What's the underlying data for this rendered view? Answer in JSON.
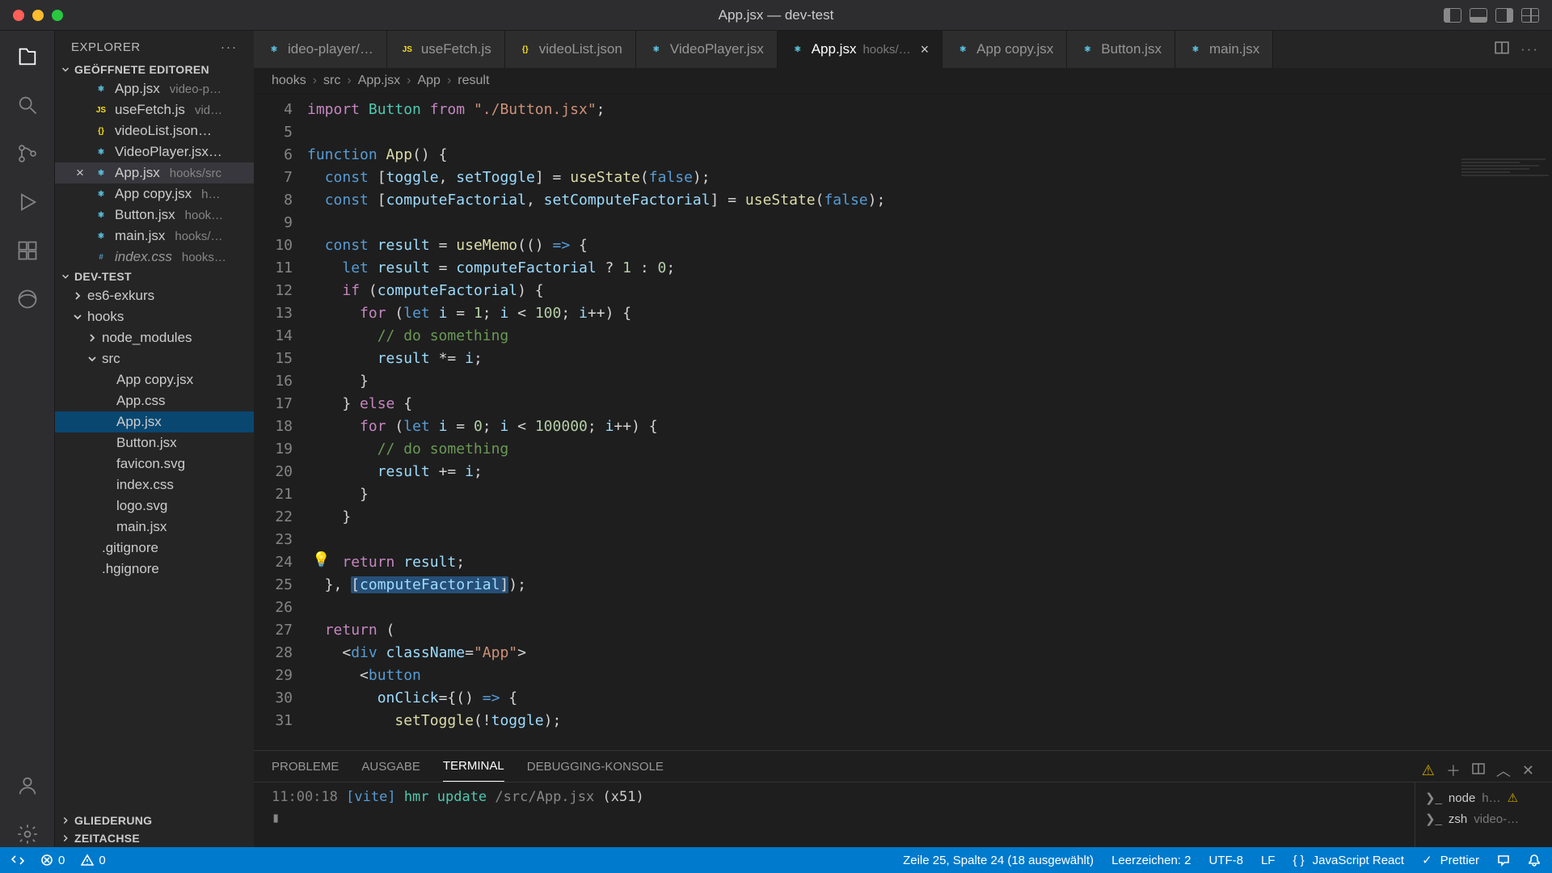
{
  "window": {
    "title": "App.jsx — dev-test"
  },
  "sidebar_header": "EXPLORER",
  "sections": {
    "open_editors": "GEÖFFNETE EDITOREN",
    "project": "DEV-TEST",
    "outline": "GLIEDERUNG",
    "timeline": "ZEITACHSE"
  },
  "open_editors": [
    {
      "name": "App.jsx",
      "path": "video-p…",
      "icon": "react"
    },
    {
      "name": "useFetch.js",
      "path": "vid…",
      "icon": "js"
    },
    {
      "name": "videoList.json…",
      "path": "",
      "icon": "json"
    },
    {
      "name": "VideoPlayer.jsx…",
      "path": "",
      "icon": "react"
    },
    {
      "name": "App.jsx",
      "path": "hooks/src",
      "icon": "react",
      "active": true,
      "close": "×"
    },
    {
      "name": "App copy.jsx",
      "path": "h…",
      "icon": "react"
    },
    {
      "name": "Button.jsx",
      "path": "hook…",
      "icon": "react"
    },
    {
      "name": "main.jsx",
      "path": "hooks/…",
      "icon": "react"
    },
    {
      "name": "index.css",
      "path": "hooks…",
      "icon": "css",
      "dim": true
    }
  ],
  "tree": [
    {
      "label": "es6-exkurs",
      "depth": 1,
      "chev": "right"
    },
    {
      "label": "hooks",
      "depth": 1,
      "chev": "down"
    },
    {
      "label": "node_modules",
      "depth": 2,
      "chev": "right"
    },
    {
      "label": "src",
      "depth": 2,
      "chev": "down"
    },
    {
      "label": "App copy.jsx",
      "depth": 3
    },
    {
      "label": "App.css",
      "depth": 3
    },
    {
      "label": "App.jsx",
      "depth": 3,
      "sel": true
    },
    {
      "label": "Button.jsx",
      "depth": 3
    },
    {
      "label": "favicon.svg",
      "depth": 3
    },
    {
      "label": "index.css",
      "depth": 3
    },
    {
      "label": "logo.svg",
      "depth": 3
    },
    {
      "label": "main.jsx",
      "depth": 3
    },
    {
      "label": ".gitignore",
      "depth": 2
    },
    {
      "label": ".hgignore",
      "depth": 2
    }
  ],
  "tabs": [
    {
      "label": "ideo-player/…",
      "icon": "react"
    },
    {
      "label": "useFetch.js",
      "icon": "js"
    },
    {
      "label": "videoList.json",
      "icon": "json"
    },
    {
      "label": "VideoPlayer.jsx",
      "icon": "react"
    },
    {
      "label": "App.jsx",
      "path": "hooks/…",
      "icon": "react",
      "active": true,
      "close": "×"
    },
    {
      "label": "App copy.jsx",
      "icon": "react"
    },
    {
      "label": "Button.jsx",
      "icon": "react"
    },
    {
      "label": "main.jsx",
      "icon": "react"
    }
  ],
  "breadcrumb": [
    "hooks",
    "src",
    "App.jsx",
    "App",
    "result"
  ],
  "code_lines": [
    {
      "n": 4,
      "html": "<span class='kw'>import</span> <span class='type'>Button</span> <span class='kw'>from</span> <span class='str'>\"./Button.jsx\"</span>;"
    },
    {
      "n": 5,
      "html": ""
    },
    {
      "n": 6,
      "html": "<span class='kw2'>function</span> <span class='fn'>App</span>() {"
    },
    {
      "n": 7,
      "html": "  <span class='kw2'>const</span> [<span class='var'>toggle</span>, <span class='var'>setToggle</span>] = <span class='fn'>useState</span>(<span class='kw2'>false</span>);"
    },
    {
      "n": 8,
      "html": "  <span class='kw2'>const</span> [<span class='var'>computeFactorial</span>, <span class='var'>setComputeFactorial</span>] = <span class='fn'>useState</span>(<span class='kw2'>false</span>);"
    },
    {
      "n": 9,
      "html": ""
    },
    {
      "n": 10,
      "html": "  <span class='kw2'>const</span> <span class='var'>result</span> = <span class='fn'>useMemo</span>(() <span class='kw2'>=&gt;</span> {"
    },
    {
      "n": 11,
      "html": "    <span class='kw2'>let</span> <span class='var'>result</span> = <span class='var'>computeFactorial</span> ? <span class='num'>1</span> : <span class='num'>0</span>;"
    },
    {
      "n": 12,
      "html": "    <span class='kw'>if</span> (<span class='var'>computeFactorial</span>) {"
    },
    {
      "n": 13,
      "html": "      <span class='kw'>for</span> (<span class='kw2'>let</span> <span class='var'>i</span> = <span class='num'>1</span>; <span class='var'>i</span> &lt; <span class='num'>100</span>; <span class='var'>i</span>++) {"
    },
    {
      "n": 14,
      "html": "        <span class='com'>// do something</span>"
    },
    {
      "n": 15,
      "html": "        <span class='var'>result</span> *= <span class='var'>i</span>;"
    },
    {
      "n": 16,
      "html": "      }"
    },
    {
      "n": 17,
      "html": "    } <span class='kw'>else</span> {"
    },
    {
      "n": 18,
      "html": "      <span class='kw'>for</span> (<span class='kw2'>let</span> <span class='var'>i</span> = <span class='num'>0</span>; <span class='var'>i</span> &lt; <span class='num'>100000</span>; <span class='var'>i</span>++) {"
    },
    {
      "n": 19,
      "html": "        <span class='com'>// do something</span>"
    },
    {
      "n": 20,
      "html": "        <span class='var'>result</span> += <span class='var'>i</span>;"
    },
    {
      "n": 21,
      "html": "      }"
    },
    {
      "n": 22,
      "html": "    }"
    },
    {
      "n": 23,
      "html": ""
    },
    {
      "n": 24,
      "html": "    <span class='kw'>return</span> <span class='var'>result</span>;"
    },
    {
      "n": 25,
      "html": "  }, <span class='sel-box'>[<span class='var'>computeFactorial</span>]</span>);"
    },
    {
      "n": 26,
      "html": ""
    },
    {
      "n": 27,
      "html": "  <span class='kw'>return</span> ("
    },
    {
      "n": 28,
      "html": "    &lt;<span class='kw2'>div</span> <span class='var'>className</span>=<span class='str'>\"App\"</span>&gt;"
    },
    {
      "n": 29,
      "html": "      &lt;<span class='kw2'>button</span>"
    },
    {
      "n": 30,
      "html": "        <span class='var'>onClick</span>={() <span class='kw2'>=&gt;</span> {"
    },
    {
      "n": 31,
      "html": "          <span class='fn'>setToggle</span>(!<span class='var'>toggle</span>);"
    }
  ],
  "panel_tabs": {
    "problems": "PROBLEME",
    "output": "AUSGABE",
    "terminal": "TERMINAL",
    "debug": "DEBUGGING-KONSOLE"
  },
  "terminal": {
    "time": "11:00:18",
    "tag": "[vite]",
    "msg1": "hmr update",
    "msg2": "/src/App.jsx",
    "count": "(x51)"
  },
  "side_terms": [
    {
      "shell": "node",
      "path": "h…",
      "warn": true
    },
    {
      "shell": "zsh",
      "path": "video-…"
    }
  ],
  "statusbar": {
    "errors": "0",
    "warnings": "0",
    "position": "Zeile 25, Spalte 24 (18 ausgewählt)",
    "spaces": "Leerzeichen: 2",
    "encoding": "UTF-8",
    "eol": "LF",
    "lang": "JavaScript React",
    "prettier": "Prettier"
  }
}
